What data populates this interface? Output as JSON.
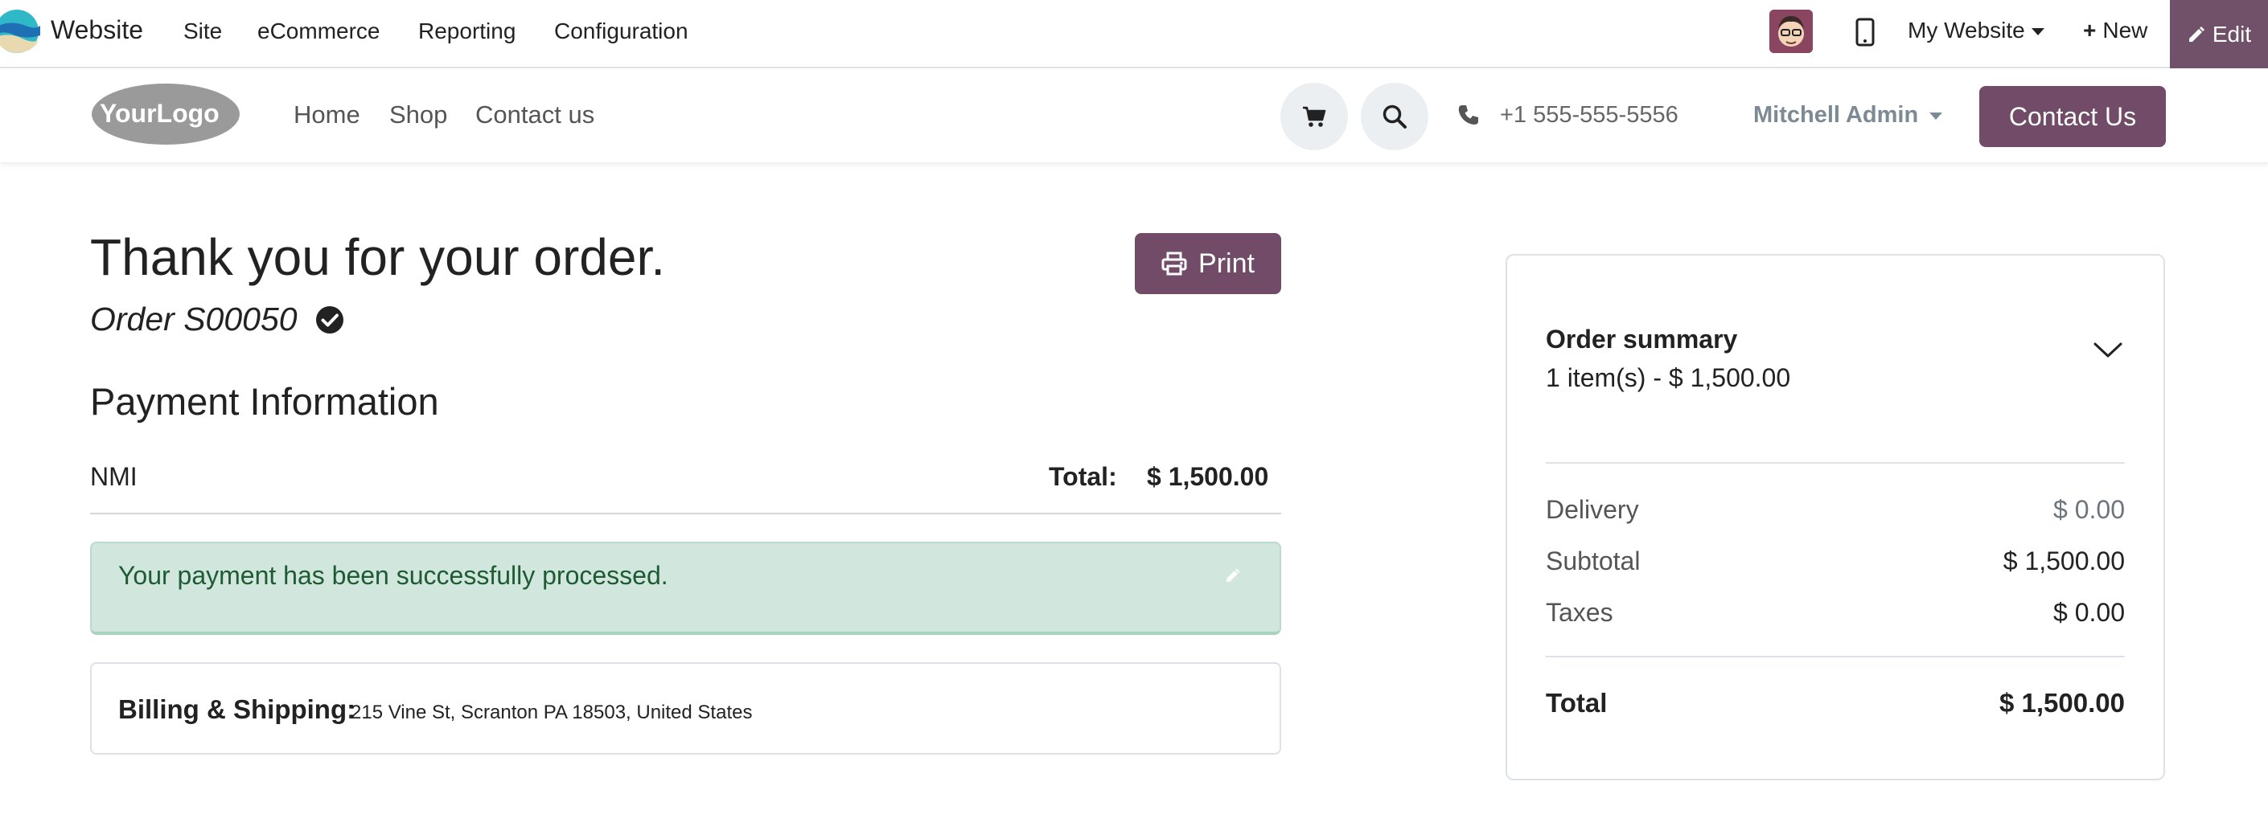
{
  "admin_bar": {
    "app_name": "Website",
    "menu": [
      "Site",
      "eCommerce",
      "Reporting",
      "Configuration"
    ],
    "website_selector": "My Website",
    "new_label": "New",
    "edit_label": "Edit"
  },
  "site_header": {
    "logo_text": "YourLogo",
    "nav": [
      "Home",
      "Shop",
      "Contact us"
    ],
    "phone": "+1 555-555-5556",
    "user": "Mitchell Admin",
    "contact_button": "Contact Us"
  },
  "order": {
    "heading": "Thank you for your order.",
    "reference": "Order S00050",
    "print_label": "Print",
    "payment_title": "Payment Information",
    "payment_method": "NMI",
    "total_label": "Total:",
    "total_value": "$ 1,500.00",
    "success_message": "Your payment has been successfully processed.",
    "billing_label": "Billing & Shipping:",
    "billing_address": "215 Vine St, Scranton PA 18503, United States"
  },
  "summary": {
    "title": "Order summary",
    "items_line": "1 item(s) -  $ 1,500.00",
    "rows": [
      {
        "label": "Delivery",
        "value": "$ 0.00"
      },
      {
        "label": "Subtotal",
        "value": "$ 1,500.00"
      },
      {
        "label": "Taxes",
        "value": "$ 0.00"
      }
    ],
    "total_label": "Total",
    "total_value": "$ 1,500.00"
  },
  "colors": {
    "brand": "#714b67",
    "success_bg": "#d1e7dd",
    "success_text": "#1e5a34"
  },
  "icons": [
    "website-app-icon",
    "avatar",
    "mobile-icon",
    "plus-icon",
    "pencil-icon",
    "cart-icon",
    "search-icon",
    "phone-icon",
    "check-circle-icon",
    "printer-icon",
    "chevron-down-icon"
  ]
}
